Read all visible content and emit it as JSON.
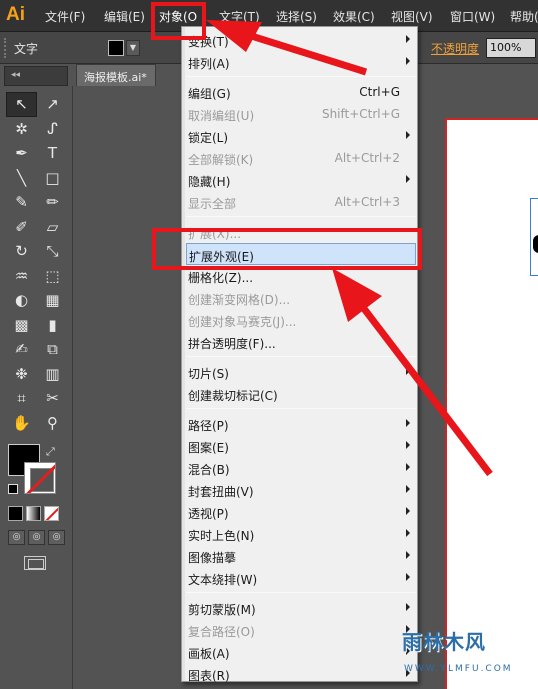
{
  "app": {
    "logo": "Ai"
  },
  "menubar": [
    {
      "label": "文件(F)",
      "active": false
    },
    {
      "label": "编辑(E)",
      "active": false
    },
    {
      "label": "对象(O",
      "active": true
    },
    {
      "label": "文字(T)",
      "active": false
    },
    {
      "label": "选择(S)",
      "active": false
    },
    {
      "label": "效果(C)",
      "active": false
    },
    {
      "label": "视图(V)",
      "active": false
    },
    {
      "label": "窗口(W)",
      "active": false
    },
    {
      "label": "帮助(",
      "active": false
    }
  ],
  "control_bar": {
    "type_label": "文字",
    "fill_color": "#000000",
    "opacity_label": "不透明度",
    "opacity_value": "100%"
  },
  "document_tab": {
    "title": "海报模板.ai*"
  },
  "tools": [
    "selection-icon",
    "direct-selection-icon",
    "magic-wand-icon",
    "lasso-icon",
    "pen-icon",
    "type-icon",
    "line-icon",
    "rectangle-icon",
    "paintbrush-icon",
    "pencil-icon",
    "blob-brush-icon",
    "eraser-icon",
    "rotate-icon",
    "scale-icon",
    "warp-icon",
    "free-transform-icon",
    "shape-builder-icon",
    "perspective-grid-icon",
    "mesh-icon",
    "gradient-icon",
    "eyedropper-icon",
    "blend-icon",
    "symbol-sprayer-icon",
    "column-graph-icon",
    "artboard-icon",
    "slice-icon",
    "hand-icon",
    "zoom-icon"
  ],
  "object_menu": {
    "items": [
      {
        "label": "变换(T)",
        "shortcut": "",
        "submenu": true,
        "disabled": false
      },
      {
        "label": "排列(A)",
        "shortcut": "",
        "submenu": true,
        "disabled": false
      },
      {
        "separator": true
      },
      {
        "label": "编组(G)",
        "shortcut": "Ctrl+G",
        "submenu": false,
        "disabled": false
      },
      {
        "label": "取消编组(U)",
        "shortcut": "Shift+Ctrl+G",
        "submenu": false,
        "disabled": true
      },
      {
        "label": "锁定(L)",
        "shortcut": "",
        "submenu": true,
        "disabled": false
      },
      {
        "label": "全部解锁(K)",
        "shortcut": "Alt+Ctrl+2",
        "submenu": false,
        "disabled": true
      },
      {
        "label": "隐藏(H)",
        "shortcut": "",
        "submenu": true,
        "disabled": false
      },
      {
        "label": "显示全部",
        "shortcut": "Alt+Ctrl+3",
        "submenu": false,
        "disabled": true
      },
      {
        "separator": true
      },
      {
        "label": "扩展(X)...",
        "shortcut": "",
        "submenu": false,
        "disabled": true
      },
      {
        "label": "扩展外观(E)",
        "shortcut": "",
        "submenu": false,
        "disabled": false,
        "highlighted": true
      },
      {
        "label": "栅格化(Z)...",
        "shortcut": "",
        "submenu": false,
        "disabled": false
      },
      {
        "label": "创建渐变网格(D)...",
        "shortcut": "",
        "submenu": false,
        "disabled": true
      },
      {
        "label": "创建对象马赛克(J)...",
        "shortcut": "",
        "submenu": false,
        "disabled": true
      },
      {
        "label": "拼合透明度(F)...",
        "shortcut": "",
        "submenu": false,
        "disabled": false
      },
      {
        "separator": true
      },
      {
        "label": "切片(S)",
        "shortcut": "",
        "submenu": true,
        "disabled": false
      },
      {
        "label": "创建裁切标记(C)",
        "shortcut": "",
        "submenu": false,
        "disabled": false
      },
      {
        "separator": true
      },
      {
        "label": "路径(P)",
        "shortcut": "",
        "submenu": true,
        "disabled": false
      },
      {
        "label": "图案(E)",
        "shortcut": "",
        "submenu": true,
        "disabled": false
      },
      {
        "label": "混合(B)",
        "shortcut": "",
        "submenu": true,
        "disabled": false
      },
      {
        "label": "封套扭曲(V)",
        "shortcut": "",
        "submenu": true,
        "disabled": false
      },
      {
        "label": "透视(P)",
        "shortcut": "",
        "submenu": true,
        "disabled": false
      },
      {
        "label": "实时上色(N)",
        "shortcut": "",
        "submenu": true,
        "disabled": false
      },
      {
        "label": "图像描摹",
        "shortcut": "",
        "submenu": true,
        "disabled": false
      },
      {
        "label": "文本绕排(W)",
        "shortcut": "",
        "submenu": true,
        "disabled": false
      },
      {
        "separator": true
      },
      {
        "label": "剪切蒙版(M)",
        "shortcut": "",
        "submenu": true,
        "disabled": false
      },
      {
        "label": "复合路径(O)",
        "shortcut": "",
        "submenu": true,
        "disabled": true
      },
      {
        "label": "画板(A)",
        "shortcut": "",
        "submenu": true,
        "disabled": false
      },
      {
        "label": "图表(R)",
        "shortcut": "",
        "submenu": true,
        "disabled": false
      }
    ]
  },
  "annotation_color": "#e8151b",
  "watermark": {
    "title": "雨林木风",
    "url": "WWW.YLMFU.COM"
  }
}
